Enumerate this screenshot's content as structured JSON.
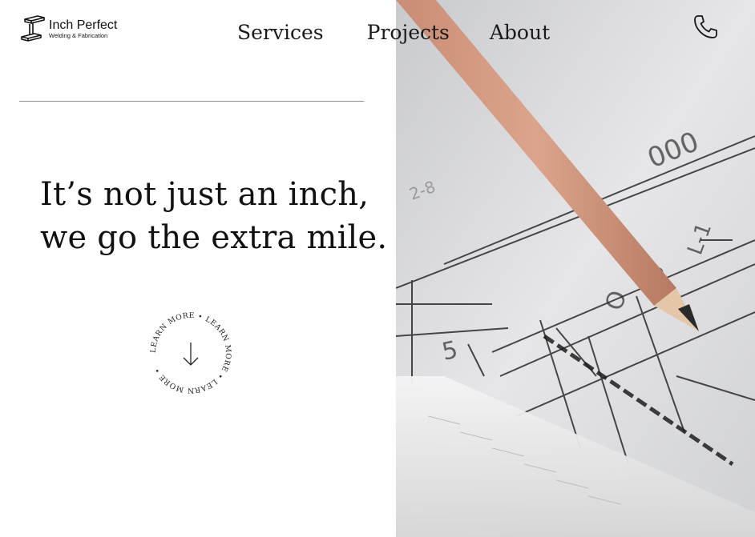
{
  "brand": {
    "name": "Inch Perfect",
    "tagline": "Welding & Fabrication"
  },
  "nav": {
    "items": [
      "Services",
      "Projects",
      "About"
    ]
  },
  "hero": {
    "headline_line1": "It’s not just an inch,",
    "headline_line2": "we go the extra mile.",
    "learn_more_ring": "LEARN MORE • LEARN MORE • LEARN MORE • "
  },
  "icons": {
    "phone": "phone-icon",
    "arrow": "arrow-down-icon",
    "logo": "i-beam-icon"
  },
  "colors": {
    "accent_dot": "#d32f2f",
    "text": "#111111",
    "rule": "#8e8e8e"
  }
}
